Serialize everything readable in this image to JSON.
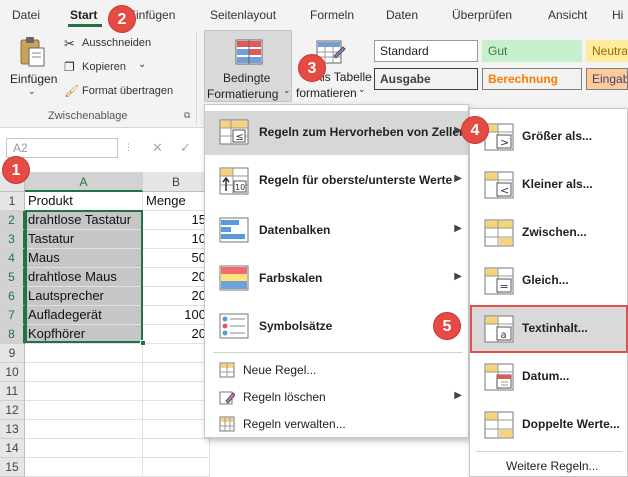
{
  "tabs": [
    {
      "label": "Datei"
    },
    {
      "label": "Start"
    },
    {
      "label": "Einfügen"
    },
    {
      "label": "Seitenlayout"
    },
    {
      "label": "Formeln"
    },
    {
      "label": "Daten"
    },
    {
      "label": "Überprüfen"
    },
    {
      "label": "Ansicht"
    },
    {
      "label": "Hi"
    }
  ],
  "ribbon": {
    "paste_label": "Einfügen",
    "cut_label": "Ausschneiden",
    "copy_label": "Kopieren",
    "format_painter_label": "Format übertragen",
    "clipboard_group_label": "Zwischenablage",
    "conditional_formatting_line1": "Bedingte",
    "conditional_formatting_line2": "Formatierung",
    "format_table_line1": "Als Tabelle",
    "format_table_line2": "formatieren",
    "styles": [
      {
        "label": "Standard",
        "bg": "#ffffff",
        "fg": "#222222",
        "border": "#9a9a9a"
      },
      {
        "label": "Gut",
        "bg": "#c6efce",
        "fg": "#2f7d32",
        "border": "#c6efce"
      },
      {
        "label": "Neutral",
        "bg": "#ffeb9c",
        "fg": "#9c6500",
        "border": "#ffeb9c"
      },
      {
        "label": "Ausgabe",
        "bg": "#f2f2f2",
        "fg": "#3f3f3f",
        "border": "#3f3f3f"
      },
      {
        "label": "Berechnung",
        "bg": "#f2f2f2",
        "fg": "#fa7d00",
        "border": "#7f7f7f"
      },
      {
        "label": "Eingabe",
        "bg": "#ffcc99",
        "fg": "#3f3f76",
        "border": "#7f7f7f"
      }
    ]
  },
  "namebox": "A2",
  "columns": [
    "A",
    "B"
  ],
  "rows": [
    "1",
    "2",
    "3",
    "4",
    "5",
    "6",
    "7",
    "8",
    "9",
    "10",
    "11",
    "12",
    "13",
    "14",
    "15"
  ],
  "sheet": {
    "header": [
      "Produkt",
      "Menge"
    ],
    "data": [
      [
        "drahtlose Tastatur",
        "15"
      ],
      [
        "Tastatur",
        "10"
      ],
      [
        "Maus",
        "50"
      ],
      [
        "drahtlose Maus",
        "20"
      ],
      [
        "Lautsprecher",
        "20"
      ],
      [
        "Aufladegerät",
        "100"
      ],
      [
        "Kopfhörer",
        "20"
      ]
    ]
  },
  "menu": {
    "highlight_rules": "Regeln zum Hervorheben von Zellen",
    "top_bottom": "Regeln für oberste/unterste Werte",
    "data_bars": "Datenbalken",
    "color_scales": "Farbskalen",
    "icon_sets": "Symbolsätze",
    "new_rule": "Neue Regel...",
    "clear_rules": "Regeln löschen",
    "manage_rules": "Regeln verwalten..."
  },
  "submenu": {
    "greater": "Größer als...",
    "less": "Kleiner als...",
    "between": "Zwischen...",
    "equal": "Gleich...",
    "text_contains": "Textinhalt...",
    "date": "Datum...",
    "duplicates": "Doppelte Werte...",
    "more_rules": "Weitere Regeln..."
  },
  "badges": [
    "1",
    "2",
    "3",
    "4",
    "5"
  ],
  "colors": {
    "accent": "#217346",
    "badge": "#e54b42"
  }
}
